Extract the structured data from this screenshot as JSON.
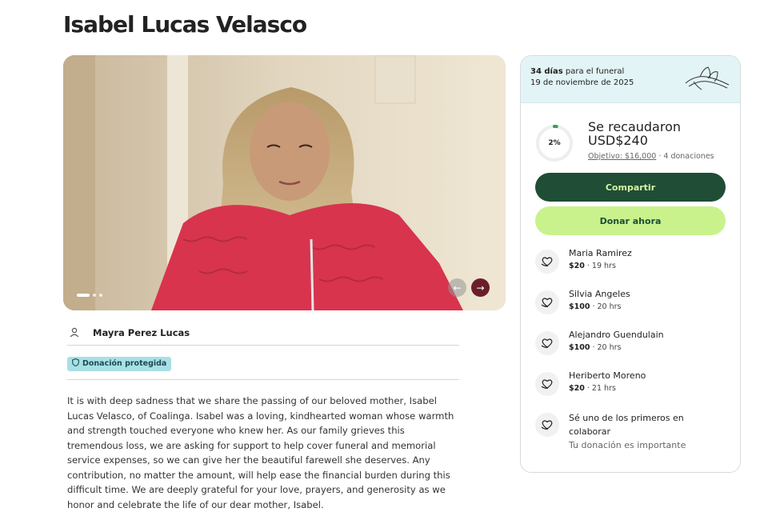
{
  "page": {
    "title": "Isabel Lucas Velasco"
  },
  "hero": {
    "alt": "Foto de Isabel Lucas Velasco",
    "slides": 3,
    "active_slide": 1
  },
  "organizer": {
    "name": "Mayra Perez Lucas"
  },
  "badge": {
    "label": "Donación protegida"
  },
  "story": {
    "text": "It is with deep sadness that we share the passing of our beloved mother, Isabel Lucas Velasco, of Coalinga. Isabel was a loving, kindhearted woman whose warmth and strength touched everyone who knew her. As our family grieves this tremendous loss, we are asking for support to help cover funeral and memorial service expenses, so we can give her the beautiful farewell she deserves. Any contribution, no matter the amount, will help ease the financial burden during this difficult time. We are deeply grateful for your love, prayers, and generosity as we honor and celebrate the life of our dear mother, Isabel."
  },
  "card": {
    "days_count": "34 días",
    "days_suffix": "para el funeral",
    "funeral_date": "19 de noviembre de 2025",
    "progress_percent": "2%",
    "progress_fraction": 0.02,
    "raised_label": "Se recaudaron",
    "raised_amount": "USD$240",
    "goal_label": "Objetivo: $16,000",
    "donations_count": "4 donaciones",
    "share_label": "Compartir",
    "donate_label": "Donar ahora",
    "donors": [
      {
        "name": "Maria Ramirez",
        "amount": "$20",
        "time": "19 hrs"
      },
      {
        "name": "Silvia Angeles",
        "amount": "$100",
        "time": "20 hrs"
      },
      {
        "name": "Alejandro Guendulain",
        "amount": "$100",
        "time": "20 hrs"
      },
      {
        "name": "Heriberto Moreno",
        "amount": "$20",
        "time": "21 hrs"
      }
    ],
    "cta_title": "Sé uno de los primeros en colaborar",
    "cta_sub": "Tu donación es importante"
  },
  "colors": {
    "share_bg": "#1f4d36",
    "donate_bg": "#c9f28d",
    "card_header_bg": "#e2f4f6",
    "badge_bg": "#a8e0e6",
    "progress": "#3b9a5e"
  },
  "icons": {
    "prev": "arrow-left-icon",
    "next": "arrow-right-icon",
    "person": "person-icon",
    "shield": "shield-icon",
    "donor": "heart-hand-icon"
  }
}
